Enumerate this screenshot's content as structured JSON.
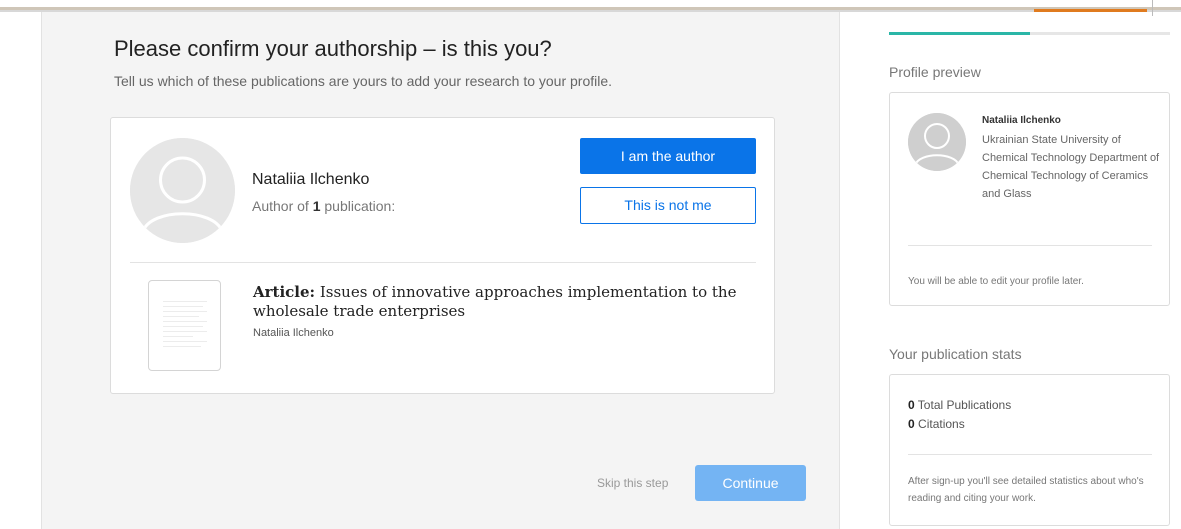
{
  "page": {
    "heading": "Please confirm your authorship – is this you?",
    "subheading": "Tell us which of these publications are yours to add your research to your profile."
  },
  "author_card": {
    "name": "Nataliia Ilchenko",
    "meta_prefix": "Author of ",
    "meta_count": "1",
    "meta_suffix": " publication:",
    "confirm_label": "I am the author",
    "reject_label": "This is not me"
  },
  "publication": {
    "type": "Article:",
    "title": " Issues of innovative approaches implementation to the wholesale trade enterprises",
    "author": "Nataliia Ilchenko"
  },
  "footer": {
    "skip_label": "Skip this step",
    "continue_label": "Continue"
  },
  "sidebar": {
    "progress_fraction": 0.5,
    "profile_preview": {
      "title": "Profile preview",
      "name": "Nataliia Ilchenko",
      "affiliation": "Ukrainian State University of Chemical Technology Department of Chemical Technology of Ceramics and Glass",
      "note": "You will be able to edit your profile later."
    },
    "stats": {
      "title": "Your publication stats",
      "publications_count": "0",
      "publications_label": " Total Publications",
      "citations_count": "0",
      "citations_label": " Citations",
      "note": "After sign-up you'll see detailed statistics about who's reading and citing your work."
    }
  },
  "colors": {
    "primary": "#0a74e8",
    "continue_disabled": "#74b4f3",
    "progress": "#2ab6a7",
    "top_accent": "#e07b1f"
  }
}
